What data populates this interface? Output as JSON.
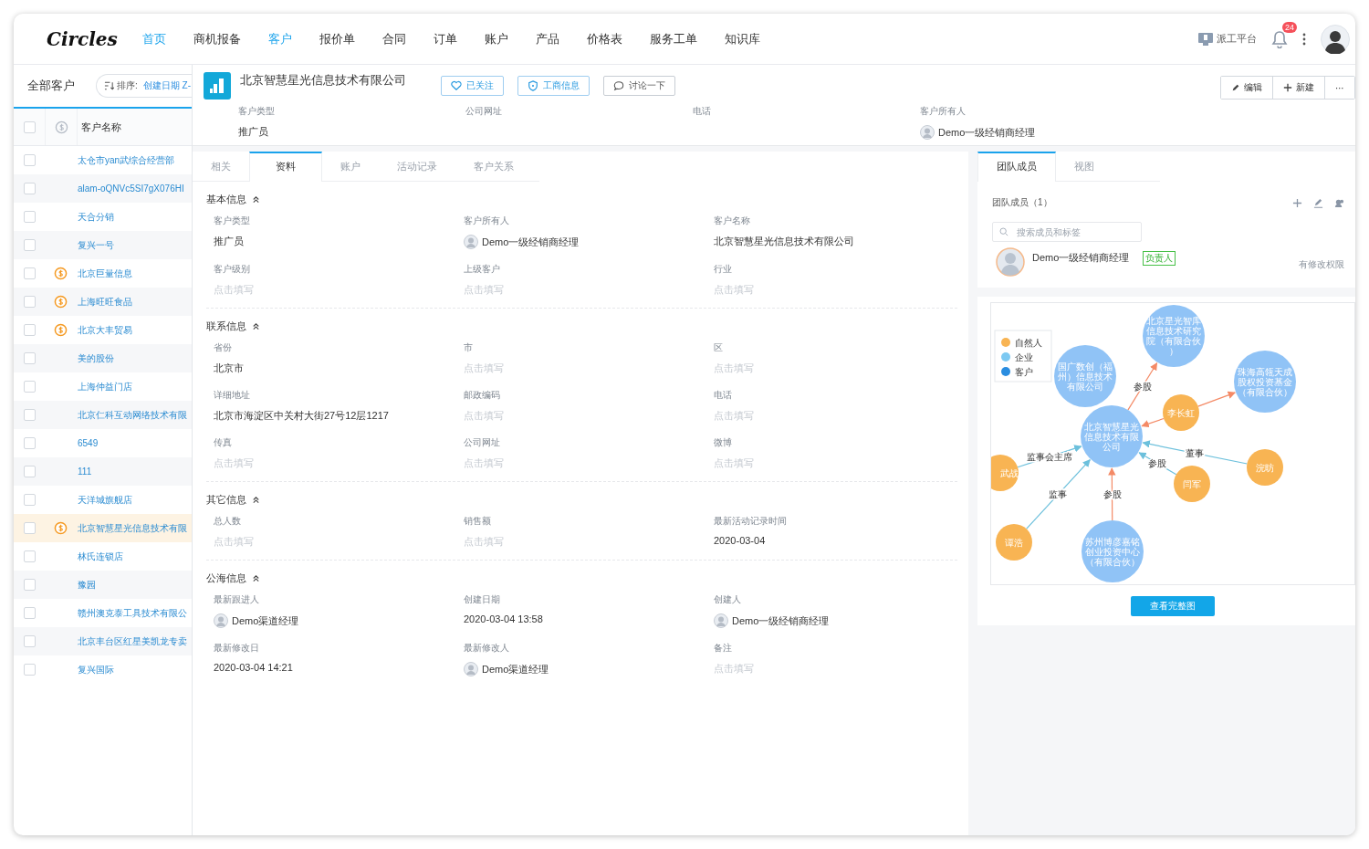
{
  "app": {
    "logo": "Circles"
  },
  "nav": [
    {
      "label": "首页",
      "selected": true
    },
    {
      "label": "商机报备",
      "selected": false
    },
    {
      "label": "客户",
      "selected": true
    },
    {
      "label": "报价单",
      "selected": false
    },
    {
      "label": "合同",
      "selected": false
    },
    {
      "label": "订单",
      "selected": false
    },
    {
      "label": "账户",
      "selected": false
    },
    {
      "label": "产品",
      "selected": false
    },
    {
      "label": "价格表",
      "selected": false
    },
    {
      "label": "服务工单",
      "selected": false
    },
    {
      "label": "知识库",
      "selected": false
    }
  ],
  "topbar": {
    "platform": "派工平台",
    "notifications": "24"
  },
  "customer_list": {
    "title": "全部客户",
    "all_checked": false,
    "sort_label": "排序:",
    "sort_value": "创建日期 Z-",
    "column": "客户名称",
    "rows": [
      {
        "name": "太仓市yan武综合经营部",
        "coin": false,
        "selected": false
      },
      {
        "name": "alam-oQNVc5SI7gX076HI",
        "coin": false,
        "selected": false
      },
      {
        "name": "天合分销",
        "coin": false,
        "selected": false
      },
      {
        "name": "复兴一号",
        "coin": false,
        "selected": false
      },
      {
        "name": "北京巨量信息",
        "coin": true,
        "selected": false
      },
      {
        "name": "上海旺旺食品",
        "coin": true,
        "selected": false
      },
      {
        "name": "北京大丰贸易",
        "coin": true,
        "selected": false
      },
      {
        "name": "美的股份",
        "coin": false,
        "selected": false
      },
      {
        "name": "上海仲益门店",
        "coin": false,
        "selected": false
      },
      {
        "name": "北京仁科互动网络技术有限",
        "coin": false,
        "selected": false
      },
      {
        "name": "6549",
        "coin": false,
        "selected": false
      },
      {
        "name": "111",
        "coin": false,
        "selected": false
      },
      {
        "name": "天洋城旗舰店",
        "coin": false,
        "selected": false
      },
      {
        "name": "北京智慧星光信息技术有限",
        "coin": true,
        "selected": true
      },
      {
        "name": "林氏连锁店",
        "coin": false,
        "selected": false
      },
      {
        "name": "豫园",
        "coin": false,
        "selected": false
      },
      {
        "name": "赣州澳克泰工具技术有限公",
        "coin": false,
        "selected": false
      },
      {
        "name": "北京丰台区红星美凯龙专卖",
        "coin": false,
        "selected": false
      },
      {
        "name": "复兴国际",
        "coin": false,
        "selected": false
      }
    ]
  },
  "header": {
    "name": "北京智慧星光信息技术有限公司",
    "actions": [
      {
        "kind": "follow",
        "label": "已关注"
      },
      {
        "kind": "business",
        "label": "工商信息"
      },
      {
        "kind": "discuss",
        "label": "讨论一下"
      }
    ],
    "tools": [
      {
        "kind": "edit",
        "label": "编辑"
      },
      {
        "kind": "new",
        "label": "新建"
      },
      {
        "kind": "more",
        "label": "⋯"
      }
    ],
    "summary": [
      {
        "label": "客户类型",
        "kind": "text",
        "value": "推广员"
      },
      {
        "label": "公司网址",
        "kind": "text"
      },
      {
        "label": "电话",
        "kind": "text"
      },
      {
        "label": "客户所有人",
        "kind": "person",
        "value": "Demo一级经销商经理"
      }
    ]
  },
  "tabs": [
    {
      "label": "相关",
      "selected": false
    },
    {
      "label": "资料",
      "selected": true
    },
    {
      "label": "账户",
      "selected": false
    },
    {
      "label": "活动记录",
      "selected": false
    },
    {
      "label": "客户关系",
      "selected": false
    }
  ],
  "sections": [
    {
      "title": "基本信息",
      "expanded": true,
      "fields": [
        {
          "label": "客户类型",
          "kind": "text",
          "value": "推广员"
        },
        {
          "label": "客户所有人",
          "kind": "person",
          "value": "Demo一级经销商经理"
        },
        {
          "label": "客户名称",
          "kind": "text",
          "value": "北京智慧星光信息技术有限公司"
        },
        {
          "label": "客户级别",
          "kind": "empty",
          "value": "点击填写"
        },
        {
          "label": "上级客户",
          "kind": "empty",
          "value": "点击填写"
        },
        {
          "label": "行业",
          "kind": "empty",
          "value": "点击填写"
        }
      ]
    },
    {
      "title": "联系信息",
      "expanded": true,
      "fields": [
        {
          "label": "省份",
          "kind": "text",
          "value": "北京市"
        },
        {
          "label": "市",
          "kind": "empty",
          "value": "点击填写"
        },
        {
          "label": "区",
          "kind": "empty",
          "value": "点击填写"
        },
        {
          "label": "详细地址",
          "kind": "text",
          "value": "北京市海淀区中关村大街27号12层1217"
        },
        {
          "label": "邮政编码",
          "kind": "empty",
          "value": "点击填写"
        },
        {
          "label": "电话",
          "kind": "empty",
          "value": "点击填写"
        },
        {
          "label": "传真",
          "kind": "empty",
          "value": "点击填写"
        },
        {
          "label": "公司网址",
          "kind": "empty",
          "value": "点击填写"
        },
        {
          "label": "微博",
          "kind": "empty",
          "value": "点击填写"
        }
      ]
    },
    {
      "title": "其它信息",
      "expanded": true,
      "fields": [
        {
          "label": "总人数",
          "kind": "empty",
          "value": "点击填写"
        },
        {
          "label": "销售额",
          "kind": "empty",
          "value": "点击填写"
        },
        {
          "label": "最新活动记录时间",
          "kind": "text",
          "value": "2020-03-04"
        }
      ]
    },
    {
      "title": "公海信息",
      "expanded": true,
      "fields": [
        {
          "label": "最新跟进人",
          "kind": "person",
          "value": "Demo渠道经理"
        },
        {
          "label": "创建日期",
          "kind": "text",
          "value": "2020-03-04 13:58"
        },
        {
          "label": "创建人",
          "kind": "person",
          "value": "Demo一级经销商经理"
        },
        {
          "label": "最新修改日",
          "kind": "text",
          "value": "2020-03-04 14:21"
        },
        {
          "label": "最新修改人",
          "kind": "person",
          "value": "Demo渠道经理"
        },
        {
          "label": "备注",
          "kind": "empty",
          "value": "点击填写"
        }
      ]
    }
  ],
  "side_tabs": [
    {
      "label": "团队成员",
      "selected": true
    },
    {
      "label": "视图",
      "selected": false
    }
  ],
  "team": {
    "title": "团队成员（1）",
    "search_placeholder": "搜索成员和标签",
    "members": [
      {
        "name": "Demo一级经销商经理",
        "tag": "负责人",
        "permission": "有修改权限"
      }
    ]
  },
  "graph": {
    "legend": [
      {
        "label": "自然人",
        "color": "#f8b453"
      },
      {
        "label": "企业",
        "color": "#7dc9f2"
      },
      {
        "label": "客户",
        "color": "#2a8de0"
      }
    ],
    "nodes": [
      {
        "kind": "company",
        "lines": [
          "北京智慧星光",
          "信息技术有限",
          "公司"
        ]
      },
      {
        "kind": "company",
        "lines": [
          "北京星光智库",
          "信息技术研究",
          "院（有限合伙",
          "）"
        ]
      },
      {
        "kind": "company",
        "lines": [
          "国广数创（福",
          "州）信息技术",
          "有限公司"
        ]
      },
      {
        "kind": "company",
        "lines": [
          "珠海高瓴天成",
          "股权投资基金",
          "（有限合伙）"
        ]
      },
      {
        "kind": "person",
        "lines": [
          "李长虹"
        ]
      },
      {
        "kind": "person",
        "lines": [
          "浣昉"
        ]
      },
      {
        "kind": "person",
        "lines": [
          "闫军"
        ]
      },
      {
        "kind": "person",
        "lines": [
          "谭浩"
        ]
      },
      {
        "kind": "company",
        "lines": [
          "苏州博彦嘉铭",
          "创业投资中心",
          "（有限合伙）"
        ]
      },
      {
        "kind": "person",
        "lines": [
          "武战"
        ]
      }
    ],
    "edges": [
      {
        "kind": "invest",
        "label": "参股"
      },
      {
        "kind": "invest"
      },
      {
        "kind": "invest"
      },
      {
        "kind": "role",
        "label": "董事"
      },
      {
        "kind": "role",
        "label": "参股"
      },
      {
        "kind": "role",
        "label": "监事"
      },
      {
        "kind": "invest",
        "label": "参股"
      },
      {
        "kind": "role",
        "label": "监事会主席"
      }
    ],
    "button": "查看完整图"
  }
}
